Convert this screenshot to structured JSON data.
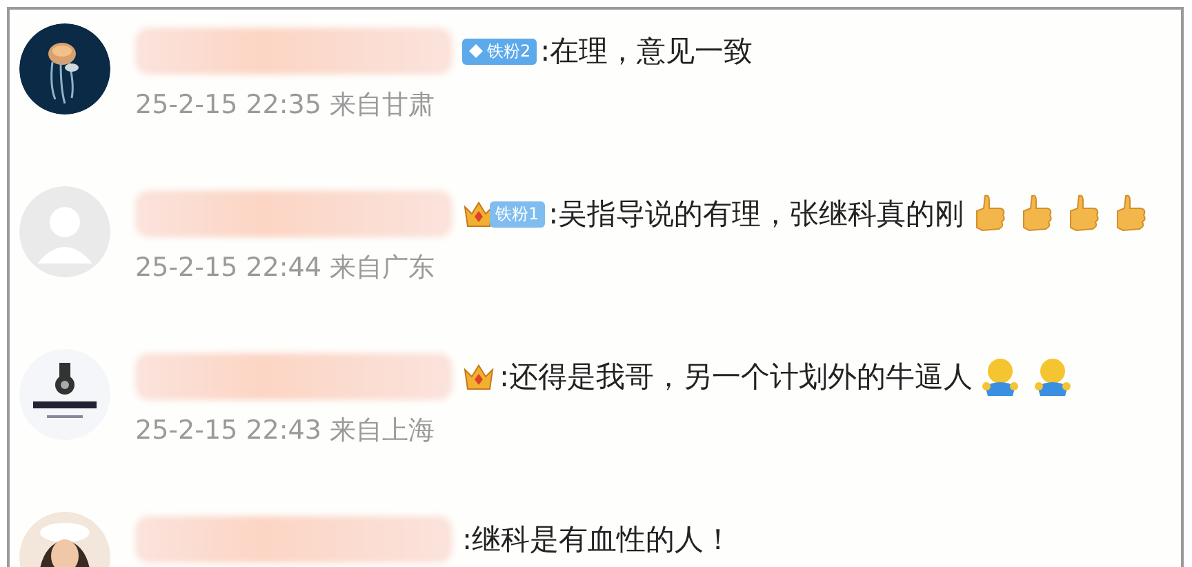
{
  "comments": [
    {
      "badge": {
        "kind": "diamond",
        "text": "铁粉2"
      },
      "text": ":在理，意见一致",
      "meta": "25-2-15 22:35 来自甘肃"
    },
    {
      "badge": {
        "kind": "crown",
        "text": "铁粉1"
      },
      "text": ":吴指导说的有理，张继科真的刚",
      "emojis": [
        {
          "kind": "thumbs-up"
        },
        {
          "kind": "thumbs-up"
        },
        {
          "kind": "thumbs-up"
        },
        {
          "kind": "thumbs-up"
        }
      ],
      "meta": "25-2-15 22:44 来自广东"
    },
    {
      "badge": {
        "kind": "crown"
      },
      "text": ":还得是我哥，另一个计划外的牛逼人",
      "emojis": [
        {
          "kind": "hug"
        },
        {
          "kind": "hug"
        }
      ],
      "meta": "25-2-15 22:43 来自上海"
    },
    {
      "text": ":继科是有血性的人！"
    }
  ]
}
